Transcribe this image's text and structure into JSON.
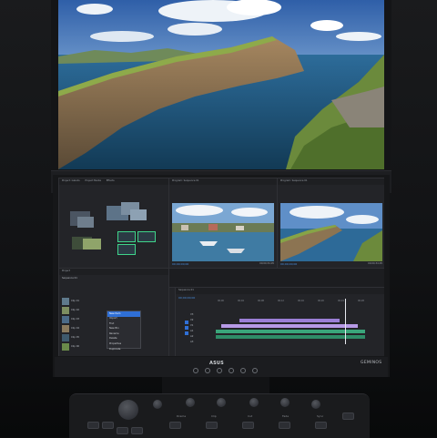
{
  "device": {
    "brand_logo_text": "ASUS",
    "model": "GEMINOS"
  },
  "editor": {
    "project_panel_tabs": [
      "Project: Islands",
      "Project Media",
      "Effects"
    ],
    "source_monitor_label": "Program: Sequence 01",
    "program_monitor_label": "Program: Sequence 01",
    "source_timecode": "00;00;00;00",
    "source_end_timecode": "00;00;34;05",
    "program_timecode": "00;00;00;00",
    "program_end_timecode": "00;00;34;05",
    "timeline_timecode": "00;00;00;00",
    "sequence_name": "Sequence 01",
    "project_name": "Project",
    "bin_rows": [
      "Clip 01",
      "Clip 02",
      "Clip 03",
      "Clip 04",
      "Clip 05",
      "Clip 06"
    ],
    "context_menu_items": [
      "New Item",
      "Import",
      "Find",
      "New Bin",
      "Rename",
      "Delete",
      "Properties",
      "Duplicate"
    ],
    "highlighted_menu_item": "New Item",
    "ruler_ticks": [
      "00;00",
      "00;04",
      "00;08",
      "00;12",
      "00;16",
      "00;20",
      "00;24",
      "00;28"
    ],
    "tracks": [
      "V3",
      "V2",
      "V1",
      "A1",
      "A2",
      "A3"
    ]
  },
  "controller": {
    "key_labels": [
      "Drama",
      "Clip",
      "Cut",
      "Fade",
      "Sync"
    ]
  },
  "colors": {
    "accent_blue": "#4a90e2",
    "clip_purple": "#9b7fd6",
    "clip_green": "#3aa57a",
    "playhead": "#e8eaf0"
  }
}
